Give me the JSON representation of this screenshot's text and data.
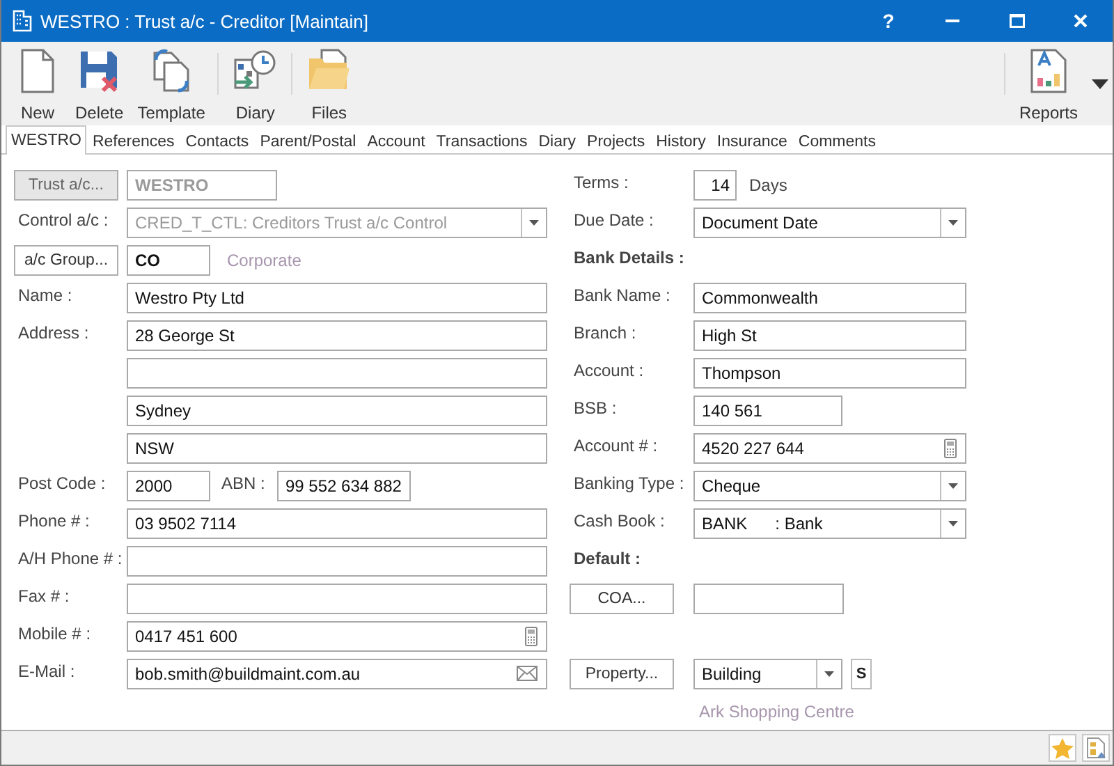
{
  "window": {
    "title": "WESTRO : Trust a/c - Creditor [Maintain]",
    "help": "?"
  },
  "toolbar": [
    {
      "label": "New"
    },
    {
      "label": "Delete"
    },
    {
      "label": "Template"
    },
    {
      "label": "Diary"
    },
    {
      "label": "Files"
    }
  ],
  "toolbar_right": {
    "label": "Reports"
  },
  "tabs": [
    {
      "label": "WESTRO",
      "selected": true
    },
    {
      "label": "References",
      "selected": false
    },
    {
      "label": "Contacts",
      "selected": false
    },
    {
      "label": "Parent/Postal",
      "selected": false
    },
    {
      "label": "Account",
      "selected": false
    },
    {
      "label": "Transactions",
      "selected": false
    },
    {
      "label": "Diary",
      "selected": false
    },
    {
      "label": "Projects",
      "selected": false
    },
    {
      "label": "History",
      "selected": false
    },
    {
      "label": "Insurance",
      "selected": false
    },
    {
      "label": "Comments",
      "selected": false
    }
  ],
  "left_rows": [
    {
      "kind": "button_field",
      "button": "Trust a/c...",
      "value": "WESTRO",
      "disabled": true
    },
    {
      "kind": "select",
      "label": "Control a/c :",
      "value": "CRED_T_CTL: Creditors Trust a/c Control",
      "disabled": true
    },
    {
      "kind": "button_field",
      "button": "a/c Group...",
      "value": "CO",
      "note": "Corporate",
      "disabled": false
    },
    {
      "kind": "field",
      "label": "Name :",
      "value": "Westro Pty Ltd"
    },
    {
      "kind": "field",
      "label": "Address :",
      "value": "28 George St"
    },
    {
      "kind": "field"
    },
    {
      "kind": "field",
      "value": "Sydney"
    },
    {
      "kind": "field",
      "value": "NSW"
    },
    {
      "kind": "pair",
      "label": "Post Code :",
      "value": "2000",
      "label2": "ABN :",
      "value2": "99 552 634 882"
    },
    {
      "kind": "field",
      "label": "Phone # :",
      "value": "03 9502 7114"
    },
    {
      "kind": "field",
      "label": "A/H Phone # :"
    },
    {
      "kind": "field",
      "label": "Fax # :"
    },
    {
      "kind": "device_field",
      "label": "Mobile # :",
      "value": "0417 451 600"
    },
    {
      "kind": "email_field",
      "label": "E-Mail :",
      "value": "bob.smith@buildmaint.com.au"
    }
  ],
  "right_rows": [
    {
      "kind": "number_unit",
      "label": "Terms :",
      "value": "14",
      "unit": "Days"
    },
    {
      "kind": "select",
      "label": "Due Date :",
      "value": "Document Date",
      "disabled": false
    },
    {
      "kind": "heading",
      "label": "Bank Details :"
    },
    {
      "kind": "field",
      "label": "Bank Name :",
      "value": "Commonwealth"
    },
    {
      "kind": "field",
      "label": "Branch :",
      "value": "High St"
    },
    {
      "kind": "field",
      "label": "Account :",
      "value": "Thompson"
    },
    {
      "kind": "short_field",
      "label": "BSB :",
      "value": "140 561"
    },
    {
      "kind": "device_field",
      "label": "Account # :",
      "value": "4520 227 644"
    },
    {
      "kind": "select",
      "label": "Banking Type :",
      "value": "Cheque",
      "disabled": false
    },
    {
      "kind": "select",
      "label": "Cash Book :",
      "value": "BANK      : Bank",
      "disabled": false
    },
    {
      "kind": "heading",
      "label": "Default :"
    },
    {
      "kind": "button_field",
      "button": "COA...",
      "disabled": false
    },
    {
      "kind": "spacer"
    },
    {
      "kind": "property",
      "button": "Property...",
      "value": "Building",
      "tag": "S"
    },
    {
      "kind": "note",
      "value": "Ark Shopping Centre"
    }
  ]
}
